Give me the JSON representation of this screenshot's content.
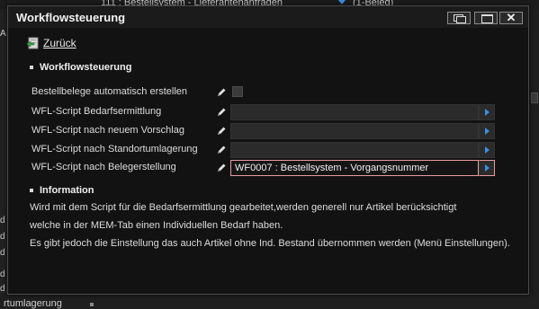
{
  "background": {
    "top_text": "111 : Bestellsystem - Lieferantenanfragen",
    "top_text2": "(1-Beleg)",
    "left_chars": [
      "A",
      "d",
      "d",
      "d",
      "d",
      "d"
    ],
    "bottom_text": "rtumlagerung"
  },
  "dialog": {
    "title": "Workflowsteuerung",
    "back_label": "Zurück"
  },
  "section1": {
    "title": "Workflowsteuerung",
    "rows": [
      {
        "label": "Bestellbelege automatisch erstellen",
        "type": "checkbox",
        "value": ""
      },
      {
        "label": "WFL-Script Bedarfsermittlung",
        "type": "field",
        "value": ""
      },
      {
        "label": "WFL-Script nach neuem Vorschlag",
        "type": "field",
        "value": ""
      },
      {
        "label": "WFL-Script nach Standortumlagerung",
        "type": "field",
        "value": ""
      },
      {
        "label": "WFL-Script nach Belegerstellung",
        "type": "field",
        "value": "WF0007   : Bestellsystem - Vorgangsnummer"
      }
    ]
  },
  "section2": {
    "title": "Information",
    "lines": [
      "Wird mit dem Script für die Bedarfsermittlung gearbeitet,werden generell nur Artikel berücksichtigt",
      "welche in der MEM-Tab einen Individuellen Bedarf haben.",
      "Es gibt jedoch die Einstellung das auch Artikel ohne Ind. Bestand übernommen werden (Menü Einstellungen)."
    ]
  },
  "colors": {
    "accent": "#3b8fe0",
    "active_border": "#e79ba0",
    "dialog_bg": "#121212"
  }
}
